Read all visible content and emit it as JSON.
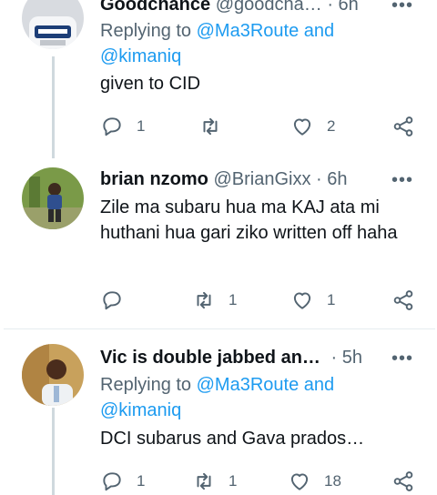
{
  "tweets": [
    {
      "name": "Goodchance",
      "handle": "@goodcha…",
      "time": "6h",
      "replying_to_label": "Replying to",
      "replying_to_1": "@Ma3Route",
      "replying_and": "and",
      "replying_to_2": "@kimaniq",
      "text": "given to CID",
      "reply_count": "1",
      "retweet_count": "",
      "like_count": "2"
    },
    {
      "name": "brian nzomo",
      "handle": "@BrianGixx",
      "time": "6h",
      "text": "Zile ma subaru hua ma KAJ ata mi huthani hua gari ziko written off haha",
      "reply_count": "",
      "retweet_count": "1",
      "like_count": "1"
    },
    {
      "name": "Vic is double jabbed an…",
      "handle": "",
      "time": "5h",
      "replying_to_label": "Replying to",
      "replying_to_1": "@Ma3Route",
      "replying_and": "and",
      "replying_to_2": "@kimaniq",
      "text": "DCI subarus and Gava prados…",
      "reply_count": "1",
      "retweet_count": "1",
      "like_count": "18"
    }
  ],
  "ui": {
    "dot": "·",
    "more": "•••"
  },
  "colors": {
    "text": "#0f1419",
    "secondary": "#536471",
    "link": "#1d9bf0",
    "divider": "#e6ecf0"
  }
}
